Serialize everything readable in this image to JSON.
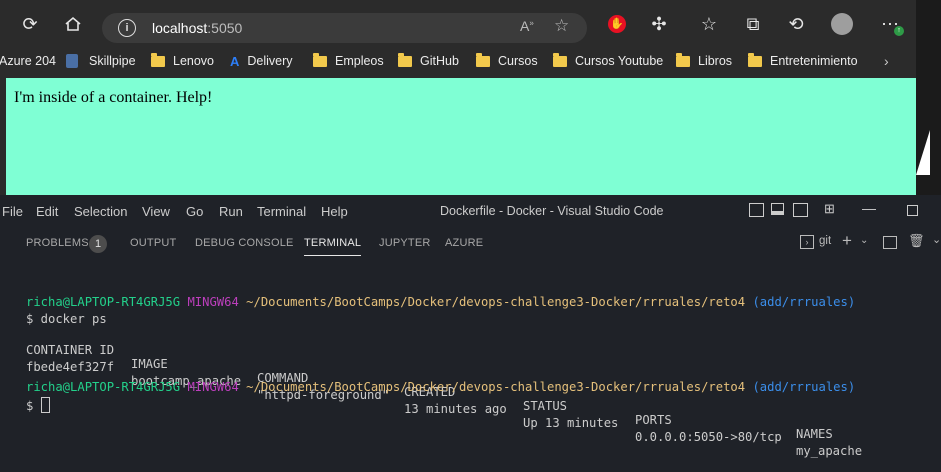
{
  "browser": {
    "address_host": "localhost",
    "address_port": ":5050",
    "bookmarks": [
      "Azure 204",
      "Skillpipe",
      "Lenovo",
      "Delivery",
      "Empleos",
      "GitHub",
      "Cursos",
      "Cursos Youtube",
      "Libros",
      "Entretenimiento"
    ],
    "page_text": "I'm inside of a container. Help!"
  },
  "vscode": {
    "menu": [
      "File",
      "Edit",
      "Selection",
      "View",
      "Go",
      "Run",
      "Terminal",
      "Help"
    ],
    "window_title": "Dockerfile - Docker - Visual Studio Code",
    "panel_tabs": [
      "PROBLEMS",
      "OUTPUT",
      "DEBUG CONSOLE",
      "TERMINAL",
      "JUPYTER",
      "AZURE"
    ],
    "problems_count": "1",
    "terminal_shell": "git",
    "terminal": {
      "prompt_user": "richa@LAPTOP-RT4GRJ5G",
      "prompt_env": "MINGW64",
      "prompt_path": "~/Documents/BootCamps/Docker/devops-challenge3-Docker/rrruales/reto4",
      "prompt_branch": "(add/rrruales)",
      "command": "$ docker ps",
      "headers": [
        "CONTAINER ID",
        "IMAGE",
        "COMMAND",
        "CREATED",
        "STATUS",
        "PORTS",
        "NAMES"
      ],
      "row": [
        "fbede4ef327f",
        "bootcamp_apache",
        "\"httpd-foreground\"",
        "13 minutes ago",
        "Up 13 minutes",
        "0.0.0.0:5050->80/tcp",
        "my_apache"
      ],
      "prompt_symbol": "$"
    }
  }
}
